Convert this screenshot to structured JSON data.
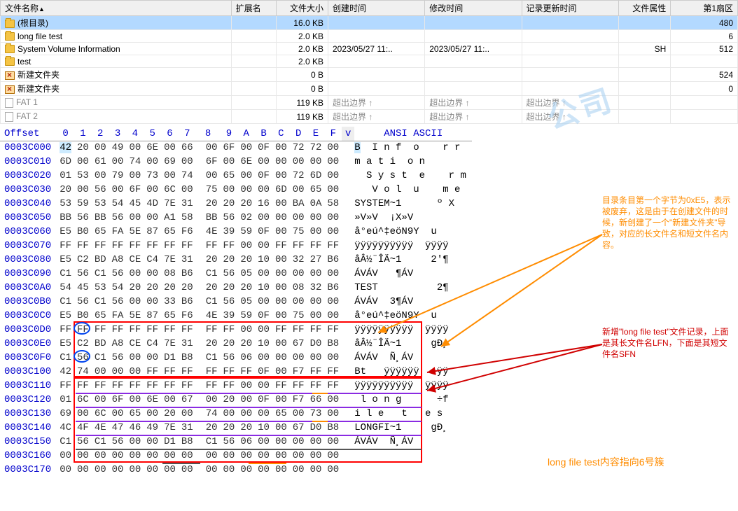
{
  "columns": {
    "name": "文件名称",
    "ext": "扩展名",
    "size": "文件大小",
    "ctime": "创建时间",
    "mtime": "修改时间",
    "rtime": "记录更新时间",
    "attr": "文件属性",
    "sect": "第1扇区"
  },
  "rows": [
    {
      "icon": "folder",
      "name": "(根目录)",
      "size": "16.0 KB",
      "sect": "480",
      "selected": true
    },
    {
      "icon": "folder",
      "name": "long file test",
      "size": "2.0 KB",
      "sect": "6"
    },
    {
      "icon": "folder",
      "name": "System Volume Information",
      "size": "2.0 KB",
      "ctime": "2023/05/27  11:..",
      "mtime": "2023/05/27  11:..",
      "attr": "SH",
      "sect": "512"
    },
    {
      "icon": "folder",
      "name": "test",
      "size": "2.0 KB"
    },
    {
      "icon": "folder-x",
      "name": "新建文件夹",
      "size": "0 B",
      "sect": "524"
    },
    {
      "icon": "folder-x",
      "name": "新建文件夹",
      "size": "0 B",
      "sect": "0"
    },
    {
      "icon": "file",
      "name": "FAT 1",
      "size": "119 KB",
      "ctime": "超出边界 ↑",
      "mtime": "超出边界 ↑",
      "rtime": "超出边界 ↑",
      "gray": true
    },
    {
      "icon": "file",
      "name": "FAT 2",
      "size": "119 KB",
      "ctime": "超出边界 ↑",
      "mtime": "超出边界 ↑",
      "rtime": "超出边界 ↑",
      "gray": true
    }
  ],
  "hex_header_offset": "Offset",
  "hex_cols": [
    "0",
    "1",
    "2",
    "3",
    "4",
    "5",
    "6",
    "7",
    "8",
    "9",
    "A",
    "B",
    "C",
    "D",
    "E",
    "F"
  ],
  "hex_vcol": "v",
  "hex_ascii_header": "ANSI ASCII",
  "hex_rows": [
    {
      "off": "0003C000",
      "b": [
        "42",
        "20",
        "00",
        "49",
        "00",
        "6E",
        "00",
        "66",
        "00",
        "6F",
        "00",
        "0F",
        "00",
        "72",
        "72",
        "00"
      ],
      "a": "B  I n f  o    r r "
    },
    {
      "off": "0003C010",
      "b": [
        "6D",
        "00",
        "61",
        "00",
        "74",
        "00",
        "69",
        "00",
        "6F",
        "00",
        "6E",
        "00",
        "00",
        "00",
        "00",
        "00"
      ],
      "a": "m a t i  o n        "
    },
    {
      "off": "0003C020",
      "b": [
        "01",
        "53",
        "00",
        "79",
        "00",
        "73",
        "00",
        "74",
        "00",
        "65",
        "00",
        "0F",
        "00",
        "72",
        "6D",
        "00"
      ],
      "a": "  S y s t  e    r m "
    },
    {
      "off": "0003C030",
      "b": [
        "20",
        "00",
        "56",
        "00",
        "6F",
        "00",
        "6C",
        "00",
        "75",
        "00",
        "00",
        "00",
        "6D",
        "00",
        "65",
        "00"
      ],
      "a": "   V o l  u    m e "
    },
    {
      "off": "0003C040",
      "b": [
        "53",
        "59",
        "53",
        "54",
        "45",
        "4D",
        "7E",
        "31",
        "20",
        "20",
        "20",
        "16",
        "00",
        "BA",
        "0A",
        "58"
      ],
      "a": "SYSTEM~1      º X"
    },
    {
      "off": "0003C050",
      "b": [
        "BB",
        "56",
        "BB",
        "56",
        "00",
        "00",
        "A1",
        "58",
        "BB",
        "56",
        "02",
        "00",
        "00",
        "00",
        "00",
        "00"
      ],
      "a": "»V»V  ¡X»V        "
    },
    {
      "off": "0003C060",
      "b": [
        "E5",
        "B0",
        "65",
        "FA",
        "5E",
        "87",
        "65",
        "F6",
        "4E",
        "39",
        "59",
        "0F",
        "00",
        "75",
        "00",
        "00"
      ],
      "a": "å°eú^‡eöN9Y  u    "
    },
    {
      "off": "0003C070",
      "b": [
        "FF",
        "FF",
        "FF",
        "FF",
        "FF",
        "FF",
        "FF",
        "FF",
        "FF",
        "FF",
        "00",
        "00",
        "FF",
        "FF",
        "FF",
        "FF"
      ],
      "a": "ÿÿÿÿÿÿÿÿÿÿ  ÿÿÿÿ"
    },
    {
      "off": "0003C080",
      "b": [
        "E5",
        "C2",
        "BD",
        "A8",
        "CE",
        "C4",
        "7E",
        "31",
        "20",
        "20",
        "20",
        "10",
        "00",
        "32",
        "27",
        "B6"
      ],
      "a": "åÂ½¨ÎÄ~1     2'¶"
    },
    {
      "off": "0003C090",
      "b": [
        "C1",
        "56",
        "C1",
        "56",
        "00",
        "00",
        "08",
        "B6",
        "C1",
        "56",
        "05",
        "00",
        "00",
        "00",
        "00",
        "00"
      ],
      "a": "ÁVÁV   ¶ÁV        "
    },
    {
      "off": "0003C0A0",
      "b": [
        "54",
        "45",
        "53",
        "54",
        "20",
        "20",
        "20",
        "20",
        "20",
        "20",
        "20",
        "10",
        "00",
        "08",
        "32",
        "B6"
      ],
      "a": "TEST          2¶"
    },
    {
      "off": "0003C0B0",
      "b": [
        "C1",
        "56",
        "C1",
        "56",
        "00",
        "00",
        "33",
        "B6",
        "C1",
        "56",
        "05",
        "00",
        "00",
        "00",
        "00",
        "00"
      ],
      "a": "ÁVÁV  3¶ÁV        "
    },
    {
      "off": "0003C0C0",
      "b": [
        "E5",
        "B0",
        "65",
        "FA",
        "5E",
        "87",
        "65",
        "F6",
        "4E",
        "39",
        "59",
        "0F",
        "00",
        "75",
        "00",
        "00"
      ],
      "a": "å°eú^‡eöN9Y  u    "
    },
    {
      "off": "0003C0D0",
      "b": [
        "FF",
        "FF",
        "FF",
        "FF",
        "FF",
        "FF",
        "FF",
        "FF",
        "FF",
        "FF",
        "00",
        "00",
        "FF",
        "FF",
        "FF",
        "FF"
      ],
      "a": "ÿÿÿÿÿÿÿÿÿÿ  ÿÿÿÿ"
    },
    {
      "off": "0003C0E0",
      "b": [
        "E5",
        "C2",
        "BD",
        "A8",
        "CE",
        "C4",
        "7E",
        "31",
        "20",
        "20",
        "20",
        "10",
        "00",
        "67",
        "D0",
        "B8"
      ],
      "a": "åÂ½¨ÎÄ~1     gÐ¸"
    },
    {
      "off": "0003C0F0",
      "b": [
        "C1",
        "56",
        "C1",
        "56",
        "00",
        "00",
        "D1",
        "B8",
        "C1",
        "56",
        "06",
        "00",
        "00",
        "00",
        "00",
        "00"
      ],
      "a": "ÁVÁV  Ñ¸ÁV        "
    },
    {
      "off": "0003C100",
      "b": [
        "42",
        "74",
        "00",
        "00",
        "00",
        "FF",
        "FF",
        "FF",
        "FF",
        "FF",
        "FF",
        "0F",
        "00",
        "F7",
        "FF",
        "FF"
      ],
      "a": "Bt   ÿÿÿÿÿÿ  ÷ÿÿ"
    },
    {
      "off": "0003C110",
      "b": [
        "FF",
        "FF",
        "FF",
        "FF",
        "FF",
        "FF",
        "FF",
        "FF",
        "FF",
        "FF",
        "00",
        "00",
        "FF",
        "FF",
        "FF",
        "FF"
      ],
      "a": "ÿÿÿÿÿÿÿÿÿÿ  ÿÿÿÿ"
    },
    {
      "off": "0003C120",
      "b": [
        "01",
        "6C",
        "00",
        "6F",
        "00",
        "6E",
        "00",
        "67",
        "00",
        "20",
        "00",
        "0F",
        "00",
        "F7",
        "66",
        "00"
      ],
      "a": " l o n g      ÷f "
    },
    {
      "off": "0003C130",
      "b": [
        "69",
        "00",
        "6C",
        "00",
        "65",
        "00",
        "20",
        "00",
        "74",
        "00",
        "00",
        "00",
        "65",
        "00",
        "73",
        "00"
      ],
      "a": "i l e   t   e s "
    },
    {
      "off": "0003C140",
      "b": [
        "4C",
        "4F",
        "4E",
        "47",
        "46",
        "49",
        "7E",
        "31",
        "20",
        "20",
        "20",
        "10",
        "00",
        "67",
        "D0",
        "B8"
      ],
      "a": "LONGFI~1     gÐ¸"
    },
    {
      "off": "0003C150",
      "b": [
        "C1",
        "56",
        "C1",
        "56",
        "00",
        "00",
        "D1",
        "B8",
        "C1",
        "56",
        "06",
        "00",
        "00",
        "00",
        "00",
        "00"
      ],
      "a": "ÁVÁV  Ñ¸ÁV        "
    },
    {
      "off": "0003C160",
      "b": [
        "00",
        "00",
        "00",
        "00",
        "00",
        "00",
        "00",
        "00",
        "00",
        "00",
        "00",
        "00",
        "00",
        "00",
        "00",
        "00"
      ],
      "a": "                "
    },
    {
      "off": "0003C170",
      "b": [
        "00",
        "00",
        "00",
        "00",
        "00",
        "00",
        "00",
        "00",
        "00",
        "00",
        "00",
        "00",
        "00",
        "00",
        "00",
        "00"
      ],
      "a": "                "
    }
  ],
  "annotations": {
    "a1": "目录条目第一个字节为0xE5，表示被废弃，这是由于在创建文件的时候，新创建了一个\"新建文件夹\"导致，对应的长文件名和短文件名内容。",
    "a2": "新增\"long file test\"文件记录，上面是其长文件名LFN，下面是其短文件名SFN",
    "a3": "long file test内容指向6号簇"
  },
  "watermark": "公司"
}
